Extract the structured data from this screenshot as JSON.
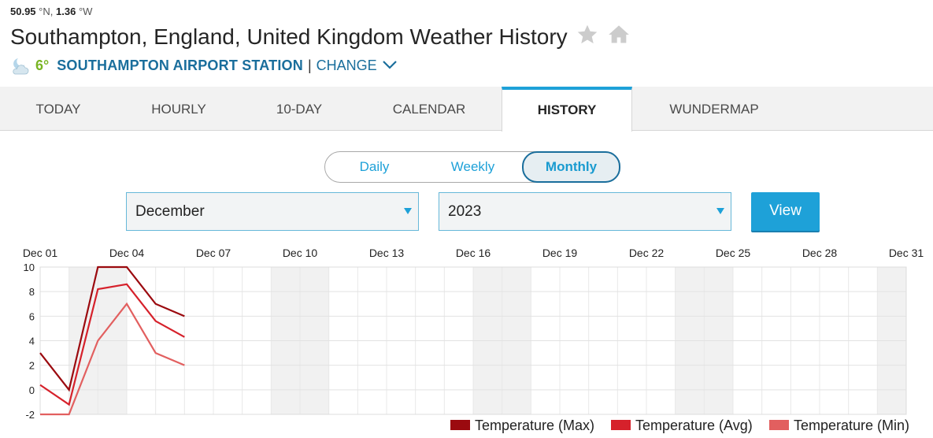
{
  "location": {
    "lat": "50.95",
    "lat_unit": "°N,",
    "lon": "1.36",
    "lon_unit": "°W",
    "title": "Southampton, England, United Kingdom Weather History"
  },
  "station": {
    "icon": "partly-cloudy-night-icon",
    "temp": "6°",
    "name": "SOUTHAMPTON AIRPORT STATION",
    "separator": "|",
    "change_label": "CHANGE"
  },
  "tabs": [
    {
      "label": "TODAY",
      "active": false
    },
    {
      "label": "HOURLY",
      "active": false
    },
    {
      "label": "10-DAY",
      "active": false
    },
    {
      "label": "CALENDAR",
      "active": false
    },
    {
      "label": "HISTORY",
      "active": true
    },
    {
      "label": "WUNDERMAP",
      "active": false
    }
  ],
  "period_toggle": {
    "options": [
      "Daily",
      "Weekly",
      "Monthly"
    ],
    "selected": "Monthly"
  },
  "filters": {
    "month": "December",
    "year": "2023",
    "view_label": "View"
  },
  "colors": {
    "accent": "#1ea1d8",
    "station_blue": "#1a6e9c",
    "temp_green": "#79b523",
    "max": "#9b0a0f",
    "avg": "#d6212b",
    "min": "#e25f5f"
  },
  "chart_data": {
    "type": "line",
    "x": [
      "Dec 01",
      "Dec 02",
      "Dec 03",
      "Dec 04",
      "Dec 05",
      "Dec 06"
    ],
    "x_tick_labels": [
      "Dec 01",
      "Dec 04",
      "Dec 07",
      "Dec 10",
      "Dec 13",
      "Dec 16",
      "Dec 19",
      "Dec 22",
      "Dec 25",
      "Dec 28",
      "Dec 31"
    ],
    "y_ticks": [
      10,
      8,
      6,
      4,
      2,
      0,
      -2
    ],
    "ylim": [
      -2,
      10
    ],
    "series": [
      {
        "name": "Temperature (Max)",
        "color": "#9b0a0f",
        "values": [
          3,
          0,
          10,
          10,
          7,
          6
        ]
      },
      {
        "name": "Temperature (Avg)",
        "color": "#d6212b",
        "values": [
          0.4,
          -1.2,
          8.2,
          8.6,
          5.6,
          4.3
        ]
      },
      {
        "name": "Temperature (Min)",
        "color": "#e25f5f",
        "values": [
          -2,
          -2,
          4,
          7,
          3,
          2
        ]
      }
    ],
    "grid": true,
    "legend": "bottom-right"
  }
}
